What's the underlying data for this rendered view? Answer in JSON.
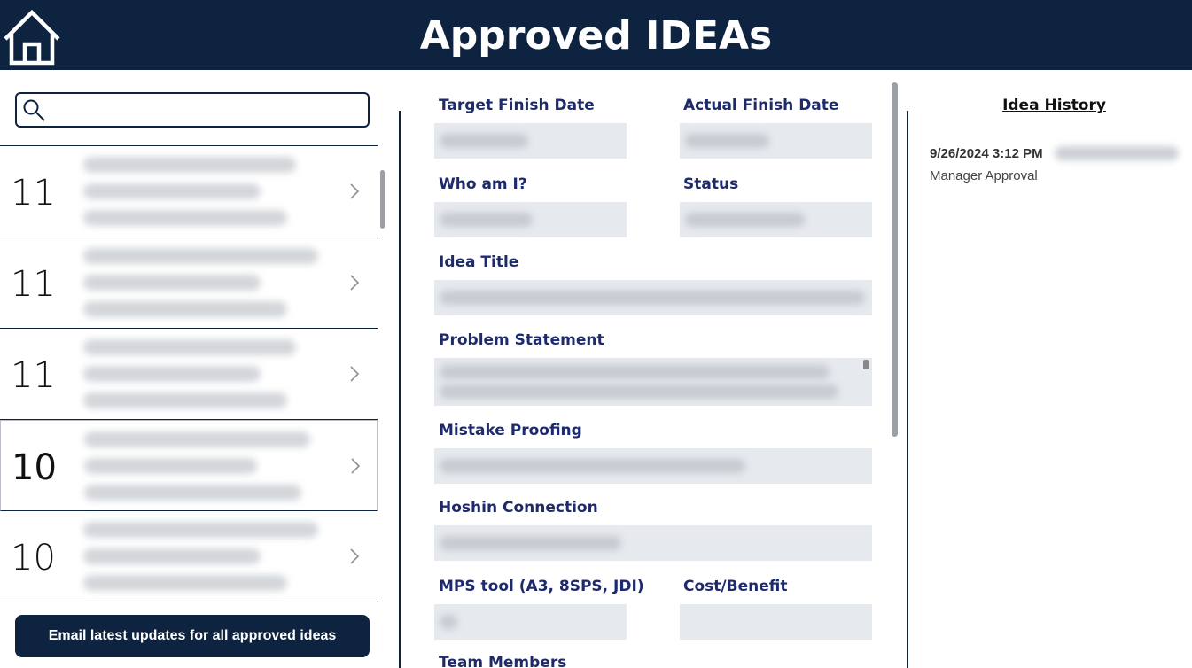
{
  "header": {
    "title": "Approved IDEAs",
    "home_icon": "home-icon"
  },
  "search": {
    "placeholder": "",
    "value": ""
  },
  "list": {
    "items": [
      {
        "number": "11"
      },
      {
        "number": "11"
      },
      {
        "number": "11"
      },
      {
        "number": "10"
      },
      {
        "number": "10"
      }
    ]
  },
  "email_button": {
    "label": "Email latest updates for all approved ideas"
  },
  "form": {
    "target_finish_date": "Target Finish Date",
    "actual_finish_date": "Actual Finish Date",
    "who_am_i": "Who am I?",
    "status": "Status",
    "idea_title": "Idea Title",
    "problem_statement": "Problem Statement",
    "mistake_proofing": "Mistake Proofing",
    "hoshin_connection": "Hoshin Connection",
    "mps_tool": "MPS tool (A3, 8SPS, JDI)",
    "cost_benefit": "Cost/Benefit",
    "team_members": "Team Members"
  },
  "history": {
    "title": "Idea History",
    "entries": [
      {
        "date": "9/26/2024 3:12 PM",
        "step": "Manager Approval"
      }
    ]
  },
  "colors": {
    "navy": "#0e2340",
    "label": "#1d2a6b",
    "field": "#e6e9ed"
  }
}
